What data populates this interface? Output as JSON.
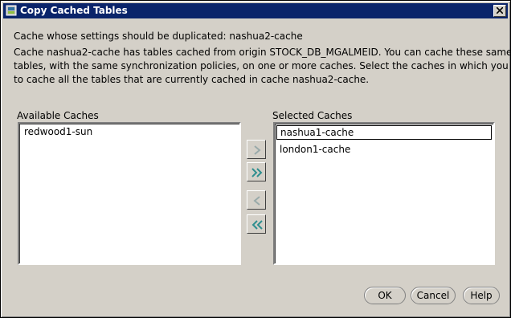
{
  "window": {
    "title": "Copy Cached Tables"
  },
  "source_line": "Cache whose settings should be duplicated: nashua2-cache",
  "description": [
    "Cache nashua2-cache has tables cached from origin STOCK_DB_MGALMEID.  You can cache these same",
    "tables, with the same synchronization policies, on one or more caches.  Select the caches in which you want",
    "to cache all the tables that are currently cached in cache nashua2-cache."
  ],
  "available": {
    "label": "Available Caches",
    "items": [
      "redwood1-sun"
    ]
  },
  "selected": {
    "label": "Selected Caches",
    "items": [
      "nashua1-cache",
      "london1-cache"
    ]
  },
  "buttons": {
    "ok": "OK",
    "cancel": "Cancel",
    "help": "Help"
  },
  "colors": {
    "titlebar": "#0a246a",
    "face": "#d4d0c8",
    "arrow": "#2f8f8f"
  }
}
